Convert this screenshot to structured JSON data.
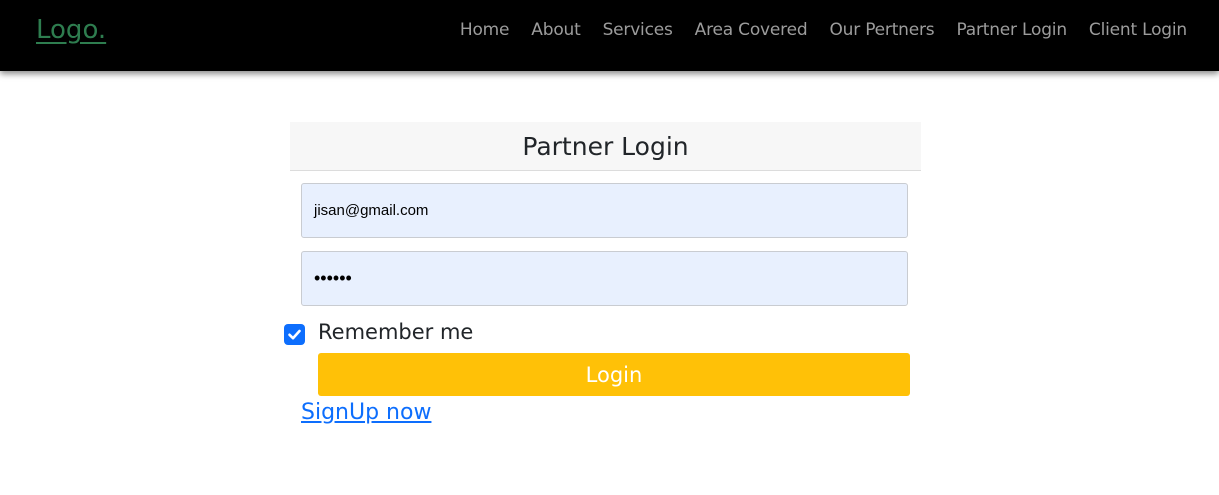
{
  "nav": {
    "logo": "Logo.",
    "links": [
      "Home",
      "About",
      "Services",
      "Area Covered",
      "Our Pertners",
      "Partner Login",
      "Client Login"
    ]
  },
  "card": {
    "title": "Partner Login"
  },
  "form": {
    "email_value": "jisan@gmail.com",
    "password_value": "••••••",
    "remember_label": "Remember me",
    "remember_checked": true,
    "login_label": "Login",
    "signup_label": "SignUp now"
  },
  "colors": {
    "navbar_bg": "#000000",
    "logo": "#2e7d4f",
    "nav_link": "#9c9c9c",
    "login_button": "#ffc107",
    "checkbox": "#0d6efd",
    "link": "#0d6efd",
    "input_bg": "#e8f0fe"
  },
  "icons": {
    "checkbox": "checkmark-icon"
  }
}
